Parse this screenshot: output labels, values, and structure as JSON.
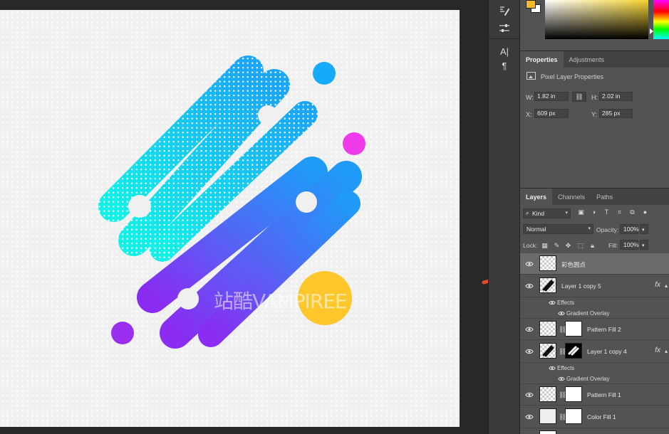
{
  "canvas": {
    "watermark": "站酷VAMPIREE",
    "colors": {
      "cyan": "#19e3ea",
      "blue": "#2f8ff5",
      "purple": "#8d34f2",
      "magenta": "#ee3ae8",
      "sky_dot": "#16aafa",
      "violet_dot": "#9a2ff0",
      "yellow": "#ffc72b"
    }
  },
  "tools": {
    "icons": [
      "brush-settings-icon",
      "adjust-sliders-icon",
      "character-icon",
      "paragraph-icon"
    ],
    "character_label": "A|",
    "paragraph_label": "¶"
  },
  "color_panel": {
    "foreground": "#f7b928",
    "background": "#ffffff"
  },
  "properties": {
    "tabs": [
      "Properties",
      "Adjustments"
    ],
    "title": "Pixel Layer Properties",
    "w_label": "W:",
    "w_value": "1.82 in",
    "h_label": "H:",
    "h_value": "2.02 in",
    "x_label": "X:",
    "x_value": "609 px",
    "y_label": "Y:",
    "y_value": "285 px"
  },
  "layers": {
    "tabs": [
      "Layers",
      "Channels",
      "Paths"
    ],
    "filter": "Kind",
    "blend_mode": "Normal",
    "opacity_label": "Opacity:",
    "opacity_value": "100%",
    "lock_label": "Lock:",
    "fill_label": "Fill:",
    "fill_value": "100%",
    "items": [
      {
        "name": "彩色圆点",
        "selected": true
      },
      {
        "name": "Layer 1 copy 5",
        "fx": "fx",
        "effects_label": "Effects",
        "effect": "Gradient Overlay"
      },
      {
        "name": "Pattern Fill 2"
      },
      {
        "name": "Layer 1 copy 4",
        "fx": "fx",
        "effects_label": "Effects",
        "effect": "Gradient Overlay"
      },
      {
        "name": "Pattern Fill 1"
      },
      {
        "name": "Color Fill 1"
      }
    ]
  }
}
